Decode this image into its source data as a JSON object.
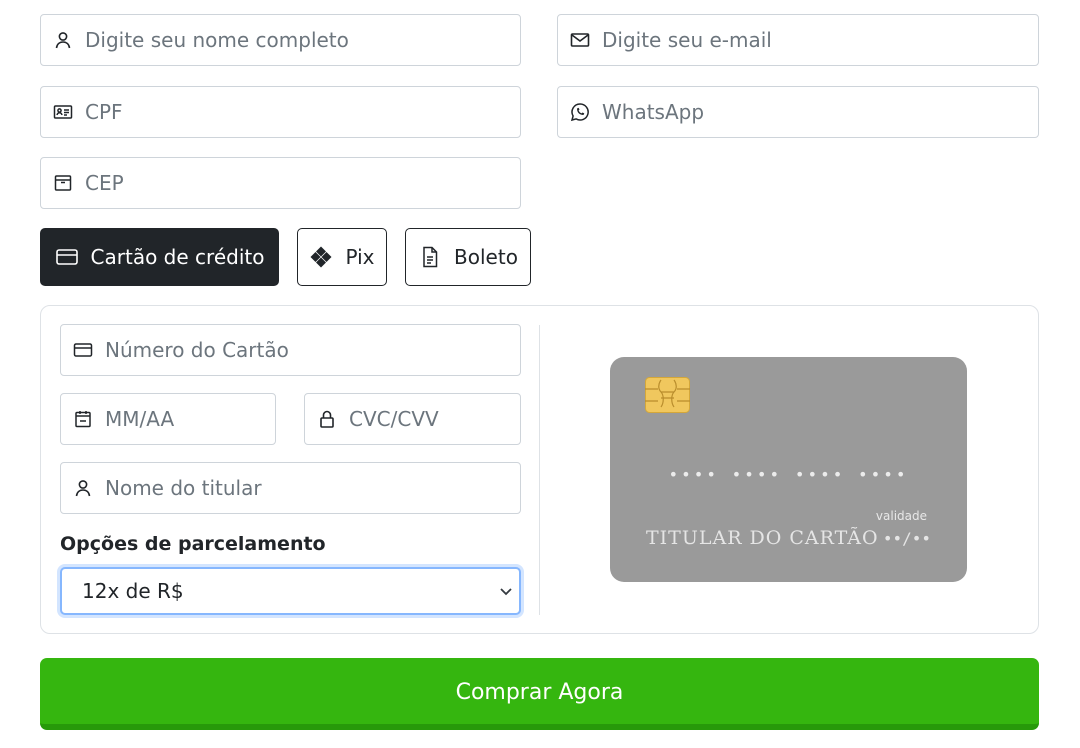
{
  "customer": {
    "name_placeholder": "Digite seu nome completo",
    "email_placeholder": "Digite seu e-mail",
    "cpf_placeholder": "CPF",
    "whatsapp_placeholder": "WhatsApp",
    "cep_placeholder": "CEP"
  },
  "payment_methods": [
    {
      "label": "Cartão de crédito",
      "icon": "credit-card-icon",
      "active": true
    },
    {
      "label": "Pix",
      "icon": "pix-icon",
      "active": false
    },
    {
      "label": "Boleto",
      "icon": "document-icon",
      "active": false
    }
  ],
  "card_form": {
    "number_placeholder": "Número do Cartão",
    "expiry_placeholder": "MM/AA",
    "cvc_placeholder": "CVC/CVV",
    "holder_placeholder": "Nome do titular",
    "installments_label": "Opções de parcelamento",
    "installments_value": "12x de R$"
  },
  "card_preview": {
    "number": "•••• •••• •••• ••••",
    "validity_label": "validade",
    "holder": "TITULAR DO CARTÃO",
    "expiry": "••/••"
  },
  "buy_button": "Comprar Agora",
  "colors": {
    "active_tab": "#212529",
    "buy_button": "#35b60f",
    "card_background": "#9a9a9a",
    "chip": "#f0c75e"
  }
}
